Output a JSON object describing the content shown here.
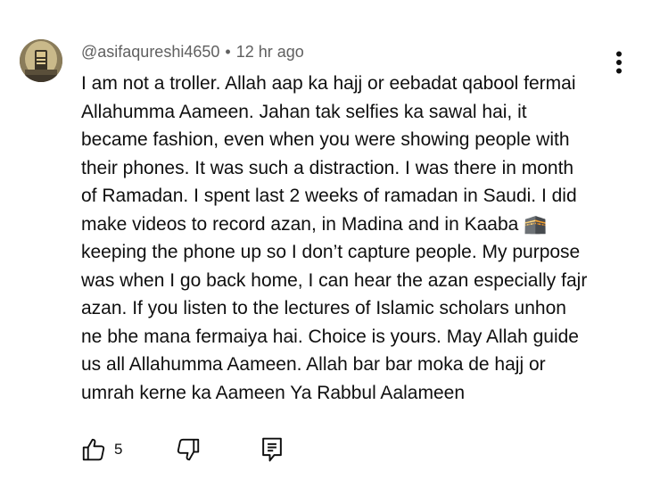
{
  "comment": {
    "author": "@asifaqureshi4650",
    "separator": "•",
    "timestamp": "12 hr ago",
    "lines": [
      "I am not a troller. Allah aap ka hajj or eebadat qabool fermai",
      "Allahumma Aameen. Jahan tak selfies ka sawal hai, it",
      "became fashion, even when you were showing people with",
      "their phones. It was such a distraction. I was there in month",
      "of Ramadan. I spent last 2 weeks of ramadan in Saudi. I did",
      "make videos to record azan, in Madina and in Kaaba 🕋",
      "keeping the phone up so I don’t capture people. My purpose",
      "was when I go back home, I can hear the azan especially fajr",
      "azan. If you listen to the lectures of Islamic scholars unhon",
      "ne bhe mana fermaiya hai. Choice is yours. May Allah guide",
      "us all Allahumma Aameen. Allah bar bar moka de hajj or",
      "umrah kerne ka Aameen Ya Rabbul Aalameen"
    ],
    "like_count": "5"
  },
  "icons": {
    "avatar": "user-avatar",
    "more": "more-vert-icon",
    "like": "thumb-up-icon",
    "dislike": "thumb-down-icon",
    "reply": "reply-comment-icon"
  },
  "colors": {
    "text": "#0f0f0f",
    "meta": "#606060",
    "background": "#ffffff"
  }
}
